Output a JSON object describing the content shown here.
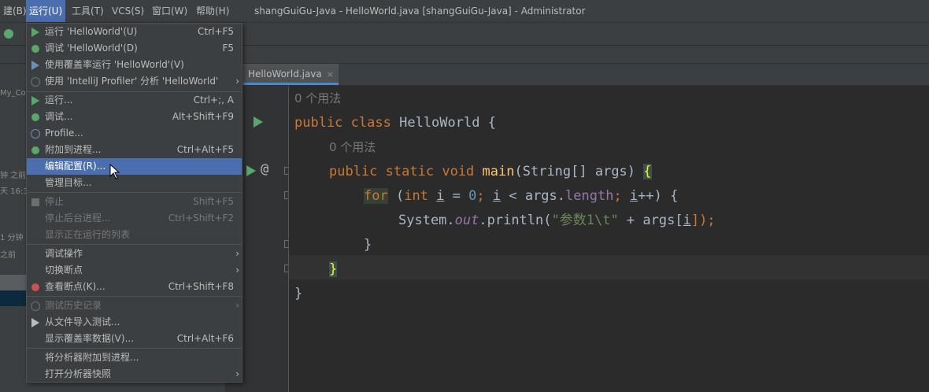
{
  "menubar": {
    "items": [
      {
        "label": "建(B)"
      },
      {
        "label": "运行(U)"
      },
      {
        "label": "工具(T)"
      },
      {
        "label": "VCS(S)"
      },
      {
        "label": "窗口(W)"
      },
      {
        "label": "帮助(H)"
      }
    ],
    "window_title": "shangGuiGu-Java - HelloWorld.java [shangGuiGu-Java] - Administrator"
  },
  "left_panel": {
    "texts": [
      "My_Co",
      "钟 之前",
      "天 16:3",
      "1 分钟",
      "之前"
    ]
  },
  "editor": {
    "tab": {
      "label": "HelloWorld.java",
      "close": "×"
    },
    "lines": {
      "hint1": "0 个用法",
      "l1_kw1": "public",
      "l1_kw2": "class",
      "l1_name": "HelloWorld",
      "l1_brace": "{",
      "hint2": "0 个用法",
      "l2_kw1": "public",
      "l2_kw2": "static",
      "l2_kw3": "void",
      "l2_fn": "main",
      "l2_params": "(String[] args) ",
      "l2_brace": "{",
      "l3_for": "for",
      "l3_a": " (",
      "l3_int": "int",
      "l3_sp": " ",
      "l3_i1": "i",
      "l3_eq": " = ",
      "l3_zero": "0",
      "l3_semi1": "; ",
      "l3_i2": "i",
      "l3_lt": " < args.",
      "l3_len": "length",
      "l3_semi2": "; ",
      "l3_i3": "i",
      "l3_end": "++) {",
      "l4_sys": "System.",
      "l4_out": "out",
      "l4_pr": ".println(",
      "l4_str": "\"参数1\\t\"",
      "l4_plus": " + args[",
      "l4_i": "i",
      "l4_end": "]);",
      "l5_brace": "}",
      "l6_brace": "}",
      "l7_brace": "}"
    },
    "gutter_at": "@"
  },
  "run_menu": {
    "items": [
      {
        "label": "运行 'HelloWorld'(U)",
        "shortcut": "Ctrl+F5",
        "icon": "play-icon"
      },
      {
        "label": "调试 'HelloWorld'(D)",
        "shortcut": "F5",
        "icon": "debug-icon"
      },
      {
        "label": "使用覆盖率运行  'HelloWorld'(V)",
        "shortcut": "",
        "icon": "coverage-icon"
      },
      {
        "label": "使用 'IntelliJ Profiler' 分析  'HelloWorld'",
        "shortcut": "",
        "icon": "profiler-icon",
        "submenu": "›"
      },
      {
        "label": "运行...",
        "shortcut": "Ctrl+;, A",
        "icon": "play-icon"
      },
      {
        "label": "调试...",
        "shortcut": "Alt+Shift+F9",
        "icon": "debug-icon"
      },
      {
        "label": "Profile...",
        "shortcut": "",
        "icon": "profile-gauge-icon"
      },
      {
        "label": "附加到进程...",
        "shortcut": "Ctrl+Alt+F5",
        "icon": "attach-debugger-icon"
      },
      {
        "label": "编辑配置(R)...",
        "shortcut": "",
        "icon": ""
      },
      {
        "label": "管理目标...",
        "shortcut": "",
        "icon": ""
      },
      {
        "label": "停止",
        "shortcut": "Shift+F5",
        "icon": "stop-icon"
      },
      {
        "label": "停止后台进程...",
        "shortcut": "Ctrl+Shift+F2",
        "icon": ""
      },
      {
        "label": "显示正在运行的列表",
        "shortcut": "",
        "icon": ""
      },
      {
        "label": "调试操作",
        "shortcut": "",
        "icon": "",
        "submenu": "›"
      },
      {
        "label": "切换断点",
        "shortcut": "",
        "icon": "",
        "submenu": "›"
      },
      {
        "label": "查看断点(K)...",
        "shortcut": "Ctrl+Shift+F8",
        "icon": "breakpoints-icon"
      },
      {
        "label": "测试历史记录",
        "shortcut": "",
        "icon": "history-clock-icon",
        "submenu": "›"
      },
      {
        "label": "从文件导入测试...",
        "shortcut": "",
        "icon": "import-icon"
      },
      {
        "label": "显示覆盖率数据(V)...",
        "shortcut": "Ctrl+Alt+F6",
        "icon": ""
      },
      {
        "label": "将分析器附加到进程...",
        "shortcut": "",
        "icon": ""
      },
      {
        "label": "打开分析器快照",
        "shortcut": "",
        "icon": "",
        "submenu": "›"
      }
    ]
  },
  "colors": {
    "menu_bg": "#3c3f41",
    "selection": "#4b6eaf",
    "editor_bg": "#2b2b2b",
    "keyword": "#cc7832",
    "function": "#ffc66d",
    "run_green": "#59a869"
  }
}
